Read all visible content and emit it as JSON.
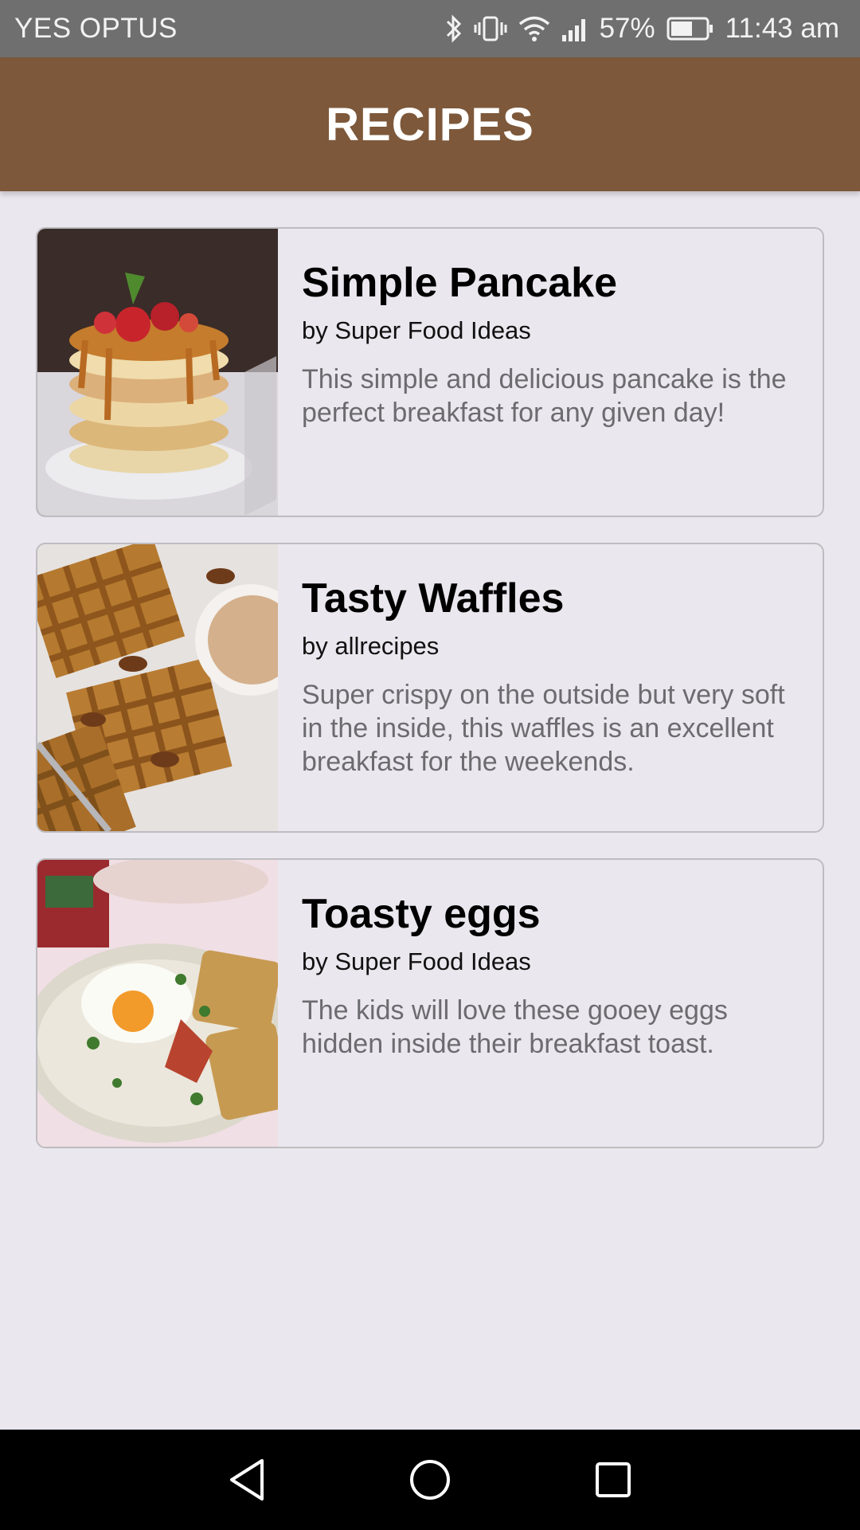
{
  "status": {
    "carrier": "YES OPTUS",
    "battery": "57%",
    "time": "11:43 am"
  },
  "app": {
    "title": "RECIPES"
  },
  "recipes": [
    {
      "title": "Simple Pancake",
      "author": "by Super Food Ideas",
      "description": "This simple and delicious pancake is the perfect breakfast for any given day!",
      "image": "pancake-stack-photo"
    },
    {
      "title": "Tasty Waffles",
      "author": "by allrecipes",
      "description": "Super crispy on the outside but very soft in the inside, this waffles is an excellent breakfast for the weekends.",
      "image": "waffles-photo"
    },
    {
      "title": "Toasty eggs",
      "author": "by Super Food Ideas",
      "description": "The kids will love these gooey eggs hidden inside their breakfast toast.",
      "image": "eggs-toast-photo"
    }
  ],
  "colors": {
    "app_bar": "#7d583a",
    "background": "#eae8ee",
    "status_bar": "#6f6f6f",
    "nav_bar": "#000000"
  },
  "icons": [
    "bluetooth-icon",
    "vibrate-icon",
    "wifi-icon",
    "signal-icon",
    "battery-icon",
    "back-icon",
    "home-icon",
    "recents-icon"
  ]
}
